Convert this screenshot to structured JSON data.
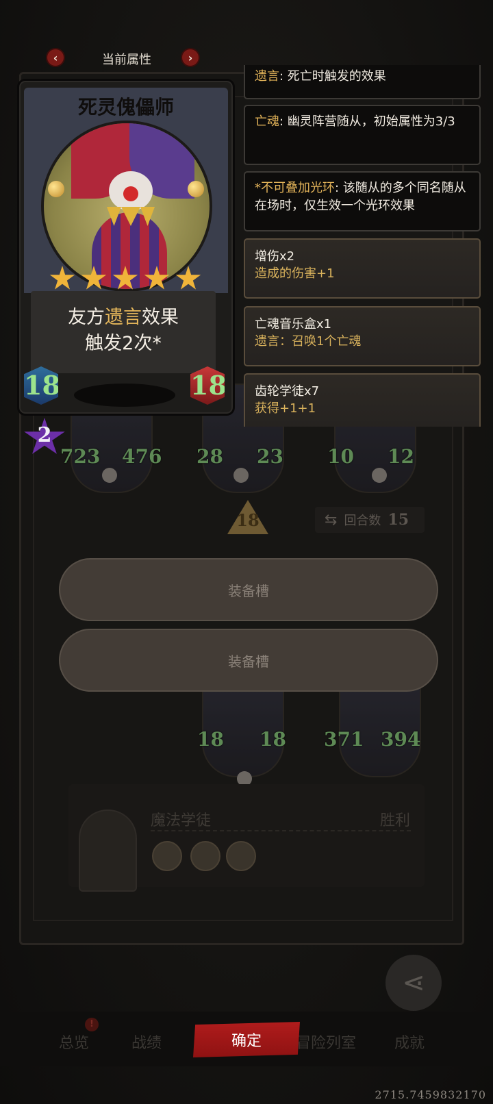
{
  "header": {
    "title": "当前属性",
    "prev_icon": "chevron-left",
    "next_icon": "chevron-right"
  },
  "card": {
    "name": "死灵傀儡师",
    "stars": 5,
    "ability_prefix": "友方",
    "ability_keyword": "遗言",
    "ability_suffix": "效果",
    "ability_line2": "触发2次*",
    "attack": "18",
    "health": "18",
    "level": "2"
  },
  "keywords": [
    {
      "term": "遗言",
      "desc": ": 死亡时触发的效果"
    },
    {
      "term": "亡魂",
      "desc": ": 幽灵阵营随从，初始属性为3/3"
    },
    {
      "term": "*不可叠加光环",
      "desc": ": 该随从的多个同名随从在场时，仅生效一个光环效果"
    }
  ],
  "items": [
    {
      "title": "增伤x2",
      "desc": "造成的伤害+1"
    },
    {
      "title": "亡魂音乐盒x1",
      "desc": "遗言：召唤1个亡魂"
    },
    {
      "title": "齿轮学徒x7",
      "desc": "获得+1+1"
    }
  ],
  "board": {
    "enemy_units": [
      {
        "attack": "723",
        "health": "476"
      },
      {
        "attack": "28",
        "health": "23"
      },
      {
        "attack": "10",
        "health": "12"
      }
    ],
    "gold": "18",
    "round_label": "回合数",
    "round_number": "15",
    "slot_label_1": "装备槽",
    "slot_label_2": "装备槽",
    "ally_units": [
      {
        "attack": "18",
        "health": "18"
      },
      {
        "attack": "371",
        "health": "394"
      }
    ]
  },
  "player": {
    "name": "魔法学徒",
    "result": "胜利"
  },
  "share": {
    "label": "分享",
    "alert": "!"
  },
  "bottom_tabs": {
    "tab1": "总览",
    "tab2": "战绩",
    "tab3": "冒险列室",
    "tab4": "成就",
    "alert": "!"
  },
  "confirm_label": "确定",
  "coords": "2715.7459832170",
  "colors": {
    "confirm": "#b01c1c",
    "keyword": "#e2b359",
    "stat_green": "#9ce38c"
  }
}
